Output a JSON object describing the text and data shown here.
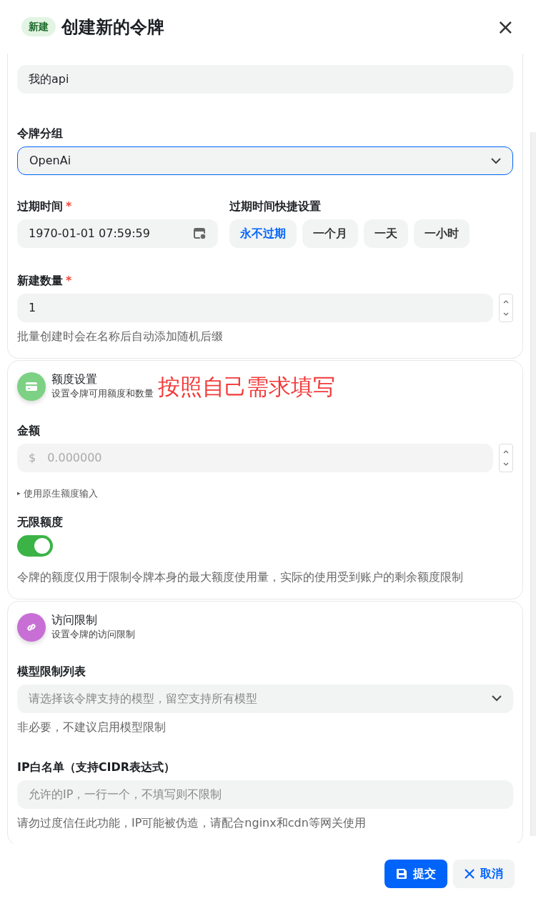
{
  "header": {
    "badge": "新建",
    "title": "创建新的令牌",
    "close": "×"
  },
  "basic": {
    "name_value": "我的api",
    "group": {
      "label": "令牌分组",
      "value": "OpenAi"
    },
    "expiry": {
      "label": "过期时间",
      "required": "*",
      "value": "1970-01-01 07:59:59"
    },
    "quick": {
      "label": "过期时间快捷设置",
      "options": [
        {
          "label": "永不过期",
          "selected": true
        },
        {
          "label": "一个月",
          "selected": false
        },
        {
          "label": "一天",
          "selected": false
        },
        {
          "label": "一小时",
          "selected": false
        }
      ]
    },
    "count": {
      "label": "新建数量",
      "required": "*",
      "value": "1",
      "help": "批量创建时会在名称后自动添加随机后缀"
    }
  },
  "quota": {
    "title": "额度设置",
    "subtitle": "设置令牌可用额度和数量",
    "annotation": "按照自己需求填写",
    "amount": {
      "label": "金额",
      "prefix": "$",
      "placeholder": "0.000000",
      "disabled": true
    },
    "raw_toggle": {
      "arrow": "▸",
      "label": "使用原生额度输入"
    },
    "unlimited": {
      "label": "无限额度",
      "on": true,
      "help": "令牌的额度仅用于限制令牌本身的最大额度使用量，实际的使用受到账户的剩余额度限制"
    }
  },
  "access": {
    "title": "访问限制",
    "subtitle": "设置令牌的访问限制",
    "models": {
      "label": "模型限制列表",
      "placeholder": "请选择该令牌支持的模型，留空支持所有模型",
      "help": "非必要，不建议启用模型限制"
    },
    "ip": {
      "label": "IP白名单（支持CIDR表达式）",
      "placeholder": "允许的IP，一行一个，不填写则不限制",
      "help": "请勿过度信任此功能，IP可能被伪造，请配合nginx和cdn等网关使用"
    }
  },
  "footer": {
    "submit": "提交",
    "cancel": "取消"
  }
}
